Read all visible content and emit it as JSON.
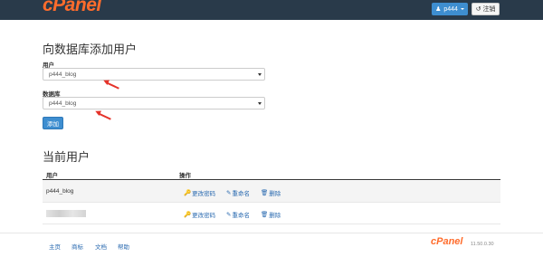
{
  "header": {
    "logo": "cPanel",
    "user_label": "p444",
    "logout_label": "注销",
    "accent": "#293a4a",
    "brand": "#ff6c2c"
  },
  "add_user": {
    "title": "向数据库添加用户",
    "user_label": "用户",
    "user_value": "p444_blog",
    "db_label": "数据库",
    "db_value": "p444_blog",
    "add_button": "添加"
  },
  "current_users": {
    "title": "当前用户",
    "col_user": "用户",
    "col_actions": "操作",
    "rows": [
      {
        "user": "p444_blog",
        "change_password": "更改密码",
        "rename": "重命名",
        "delete": "删除"
      },
      {
        "user": "",
        "change_password": "更改密码",
        "rename": "重命名",
        "delete": "删除"
      }
    ]
  },
  "footer": {
    "links": [
      "主页",
      "商标",
      "文档",
      "帮助"
    ],
    "logo": "cPanel",
    "version": "11.50.0.30"
  }
}
